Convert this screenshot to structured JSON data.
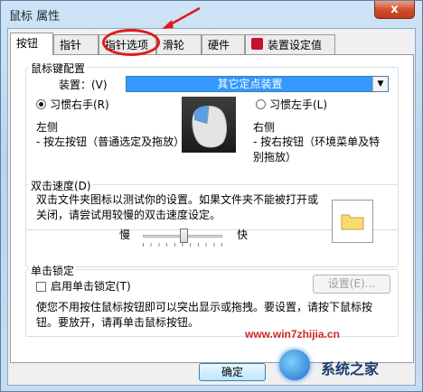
{
  "window": {
    "title": "鼠标 属性",
    "close_label": "x"
  },
  "tabs": [
    {
      "label": "按钮",
      "active": true
    },
    {
      "label": "指针",
      "active": false
    },
    {
      "label": "指针选项",
      "active": false
    },
    {
      "label": "滑轮",
      "active": false
    },
    {
      "label": "硬件",
      "active": false
    },
    {
      "label": "装置设定值",
      "active": false
    }
  ],
  "button_config": {
    "legend": "鼠标键配置",
    "device_label": "装置：(V)",
    "device_value": "其它定点装置",
    "right_handed_label": "习惯右手(R)",
    "left_handed_label": "习惯左手(L)",
    "right_handed_selected": true,
    "left_label": "左侧",
    "left_desc": "- 按左按钮（普通选定及拖放）",
    "right_label": "右侧",
    "right_desc": "- 按右按钮（环境菜单及特别拖放）"
  },
  "double_click": {
    "legend": "双击速度(D)",
    "desc": "双击文件夹图标以测试你的设置。如果文件夹不能被打开或关闭，请尝试用较慢的双击速度设定。",
    "slow_label": "慢",
    "fast_label": "快",
    "speed_fraction": 0.52
  },
  "click_lock": {
    "legend": "单击锁定",
    "checkbox_label": "启用单击锁定(T)",
    "checked": false,
    "settings_label": "设置(E)...",
    "desc": "使您不用按住鼠标按钮即可以突出显示或拖拽。要设置，请按下鼠标按钮。要放开，请再单击鼠标按钮。"
  },
  "footer": {
    "ok_label": "确定"
  },
  "watermark": {
    "url": "www.win7zhijia.cn",
    "brand": "系统之家"
  },
  "colors": {
    "annotation": "#e01b1b",
    "selection": "#3399ff"
  }
}
